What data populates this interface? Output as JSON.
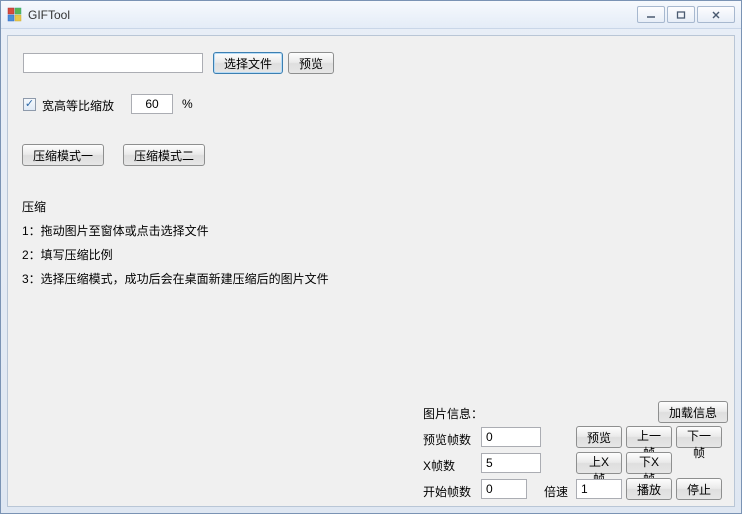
{
  "window": {
    "title": "GIFTool"
  },
  "file": {
    "path_value": "",
    "select_button": "选择文件",
    "preview_button": "预览"
  },
  "scale": {
    "checkbox_checked": true,
    "label": "宽高等比缩放",
    "value": "60",
    "unit": "%"
  },
  "mode_buttons": {
    "mode1": "压缩模式一",
    "mode2": "压缩模式二"
  },
  "instructions": {
    "heading": "压缩",
    "line1": "1：拖动图片至窗体或点击选择文件",
    "line2": "2：填写压缩比例",
    "line3": "3：选择压缩模式，成功后会在桌面新建压缩后的图片文件"
  },
  "info": {
    "section_label": "图片信息：",
    "load_button": "加载信息",
    "preview_frame_label": "预览帧数",
    "preview_frame_value": "0",
    "preview_btn": "预览",
    "prev_frame_btn": "上一帧",
    "next_frame_btn": "下一帧",
    "x_frame_label": "X帧数",
    "x_frame_value": "5",
    "up_x_btn": "上X帧",
    "down_x_btn": "下X帧",
    "start_frame_label": "开始帧数",
    "start_frame_value": "0",
    "speed_label": "倍速",
    "speed_value": "1",
    "play_btn": "播放",
    "stop_btn": "停止"
  }
}
